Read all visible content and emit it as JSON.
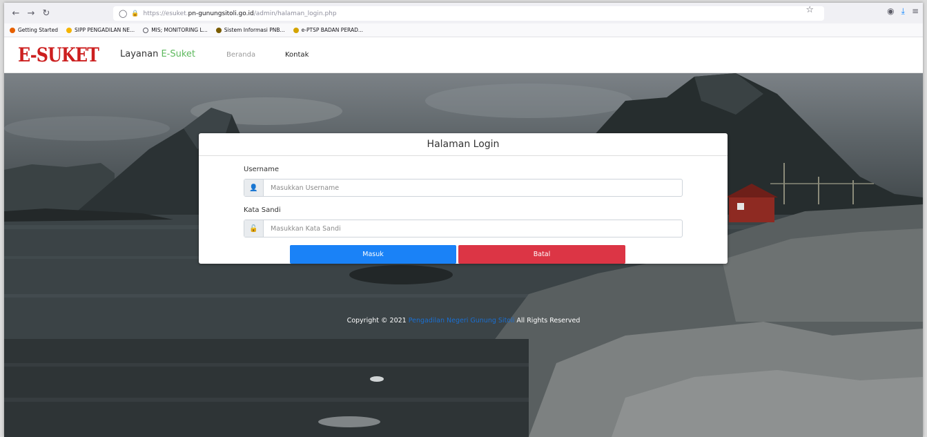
{
  "browser": {
    "url_prefix": "https://esuket.",
    "url_host": "pn-gunungsitoli.go.id",
    "url_path": "/admin/halaman_login.php",
    "bookmarks": [
      {
        "label": "Getting Started",
        "color": "#e66000"
      },
      {
        "label": "SIPP PENGADILAN NE...",
        "color": "#f5b400"
      },
      {
        "label": "MIS; MONITORING L...",
        "color": "#5b5b66"
      },
      {
        "label": "Sistem Informasi PNB...",
        "color": "#7a5c00"
      },
      {
        "label": "e-PTSP BADAN PERAD...",
        "color": "#d4a400"
      }
    ]
  },
  "site": {
    "brand": "E-SUKET",
    "title_prefix": "Layanan ",
    "title_accent": "E-Suket",
    "nav": [
      "Beranda",
      "Kontak"
    ]
  },
  "login": {
    "header": "Halaman Login",
    "username_label": "Username",
    "username_placeholder": "Masukkan Username",
    "password_label": "Kata Sandi",
    "password_placeholder": "Masukkan Kata Sandi",
    "submit_label": "Masuk",
    "cancel_label": "Batal"
  },
  "footer": {
    "prefix": "Copyright © 2021 ",
    "link": "Pengadilan Negeri Gunung Sitoli",
    "suffix": " All Rights Reserved"
  },
  "colors": {
    "brand": "#cc1f1f",
    "accent": "#5cb85c",
    "primary": "#1a82f7",
    "danger": "#dc3545"
  }
}
